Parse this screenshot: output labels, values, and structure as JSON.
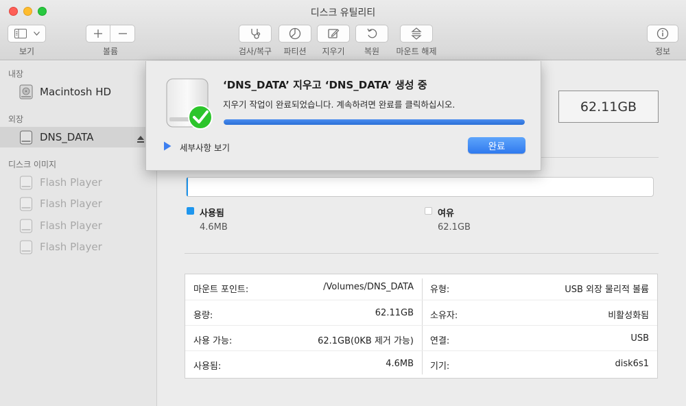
{
  "window": {
    "title": "디스크 유틸리티"
  },
  "toolbar": {
    "view_label": "보기",
    "volume_label": "볼륨",
    "firstaid_label": "검사/복구",
    "partition_label": "파티션",
    "erase_label": "지우기",
    "restore_label": "복원",
    "unmount_label": "마운트 해제",
    "info_label": "정보"
  },
  "sidebar": {
    "internal_title": "내장",
    "external_title": "외장",
    "images_title": "디스크 이미지",
    "internal_items": [
      {
        "label": "Macintosh HD",
        "icon": "internal-disk-icon"
      }
    ],
    "external_items": [
      {
        "label": "DNS_DATA",
        "icon": "external-disk-icon",
        "selected": true
      }
    ],
    "image_items": [
      {
        "label": "Flash Player",
        "icon": "disk-image-icon"
      },
      {
        "label": "Flash Player",
        "icon": "disk-image-icon"
      },
      {
        "label": "Flash Player",
        "icon": "disk-image-icon"
      },
      {
        "label": "Flash Player",
        "icon": "disk-image-icon"
      }
    ]
  },
  "main": {
    "capacity": "62.11GB",
    "used_fraction": 0.0007,
    "legend": {
      "used_label": "사용됨",
      "used_value": "4.6MB",
      "used_color": "#1e96ee",
      "free_label": "여유",
      "free_value": "62.1GB",
      "free_color": "#ffffff"
    },
    "info_left": [
      {
        "key": "마운트 포인트:",
        "value": "/Volumes/DNS_DATA"
      },
      {
        "key": "용량:",
        "value": "62.11GB"
      },
      {
        "key": "사용 가능:",
        "value": "62.1GB(0KB 제거 가능)"
      },
      {
        "key": "사용됨:",
        "value": "4.6MB"
      }
    ],
    "info_right": [
      {
        "key": "유형:",
        "value": "USB 외장 물리적 볼륨"
      },
      {
        "key": "소유자:",
        "value": "비활성화됨"
      },
      {
        "key": "연결:",
        "value": "USB"
      },
      {
        "key": "기기:",
        "value": "disk6s1"
      }
    ]
  },
  "sheet": {
    "title": "‘DNS_DATA’ 지우고 ‘DNS_DATA’ 생성 중",
    "message": "지우기 작업이 완료되었습니다. 계속하려면 완료를 클릭하십시오.",
    "progress": 1.0,
    "details_label": "세부사항 보기",
    "done_label": "완료",
    "accent_color": "#2f79ee",
    "success_color": "#2cc52b"
  }
}
